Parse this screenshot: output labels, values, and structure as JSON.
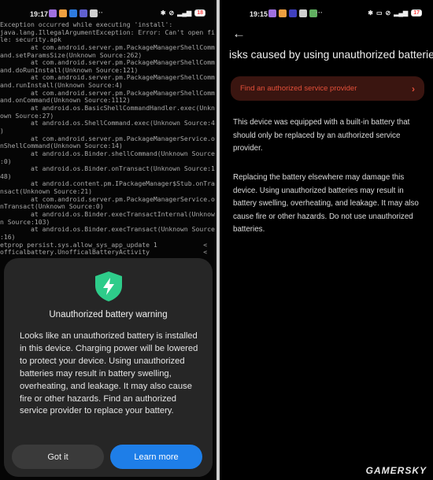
{
  "left": {
    "status": {
      "time": "19:17",
      "battery": "18"
    },
    "console_lines": [
      "Exception occurred while executing 'install':",
      "java.lang.IllegalArgumentException: Error: Can't open fi",
      "le: security.apk",
      "        at com.android.server.pm.PackageManagerShellComm",
      "and.setParamsSize(Unknown Source:262)",
      "        at com.android.server.pm.PackageManagerShellComm",
      "and.doRunInstall(Unknown Source:121)",
      "        at com.android.server.pm.PackageManagerShellComm",
      "and.runInstall(Unknown Source:4)",
      "        at com.android.server.pm.PackageManagerShellComm",
      "and.onCommand(Unknown Source:1112)",
      "        at android.os.BasicShellCommandHandler.exec(Unkn",
      "own Source:27)",
      "        at android.os.ShellCommand.exec(Unknown Source:4",
      ")",
      "        at com.android.server.pm.PackageManagerService.o",
      "nShellCommand(Unknown Source:14)",
      "        at android.os.Binder.shellCommand(Unknown Source",
      ":0)",
      "        at android.os.Binder.onTransact(Unknown Source:1",
      "48)",
      "        at android.content.pm.IPackageManager$Stub.onTra",
      "nsact(Unknown Source:21)",
      "        at com.android.server.pm.PackageManagerService.o",
      "nTransact(Unknown Source:0)",
      "        at android.os.Binder.execTransactInternal(Unknow",
      "n Source:103)",
      "        at android.os.Binder.execTransact(Unknown Source",
      ":16)",
      "etprop persist.sys.allow_sys_app_update 1            <",
      "officalbattery.UnofficalBatteryActivity              <"
    ],
    "dialog": {
      "icon": "shield-bolt-icon",
      "title": "Unauthorized battery warning",
      "body": "Looks like an unauthorized battery is installed in this device. Charging power will be lowered to protect your device. Using unauthorized batteries may result in battery swelling, overheating, and leakage. It may also cause fire or other hazards. Find an authorized service provider to replace your battery.",
      "got_it": "Got it",
      "learn_more": "Learn more"
    }
  },
  "right": {
    "status": {
      "time": "19:15",
      "battery": "17"
    },
    "title": "isks caused by using unauthorized batterie",
    "service_button": "Find an authorized service provider",
    "paragraph1": "This device was equipped with a built-in battery that should only be replaced by an authorized service provider.",
    "paragraph2": "Replacing the battery elsewhere may damage this device. Using unauthorized batteries may result in battery swelling, overheating, and leakage. It may also cause fire or other hazards. Do not use unauthorized batteries."
  },
  "watermark": "GAMERSKY",
  "colors": {
    "accent_blue": "#1e7ee8",
    "warning_red": "#e4503a",
    "shield_green": "#2ecc8a"
  }
}
